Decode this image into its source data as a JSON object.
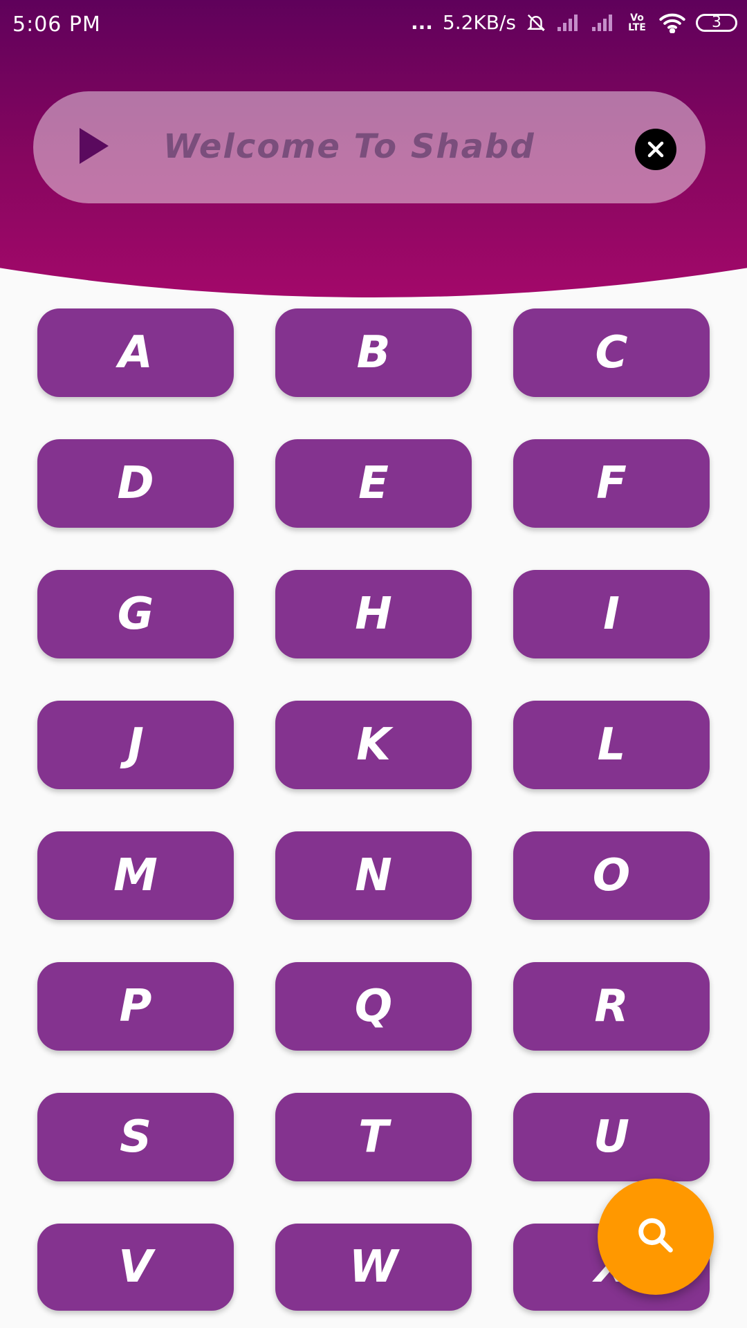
{
  "status_bar": {
    "time": "5:06 PM",
    "dots": "...",
    "net_speed": "5.2KB/s",
    "battery": "3",
    "volte": "Vo LTE"
  },
  "header": {
    "welcome_text": "Welcome To Shabd",
    "play_icon": "play-icon",
    "close_icon": "close-icon"
  },
  "letters": [
    "A",
    "B",
    "C",
    "D",
    "E",
    "F",
    "G",
    "H",
    "I",
    "J",
    "K",
    "L",
    "M",
    "N",
    "O",
    "P",
    "Q",
    "R",
    "S",
    "T",
    "U",
    "V",
    "W",
    "X"
  ],
  "fab": {
    "icon": "search-icon",
    "color": "#ff9800"
  },
  "colors": {
    "header_top": "#56005a",
    "header_bottom": "#a3086a",
    "button": "#84338f",
    "background": "#fafafa"
  }
}
